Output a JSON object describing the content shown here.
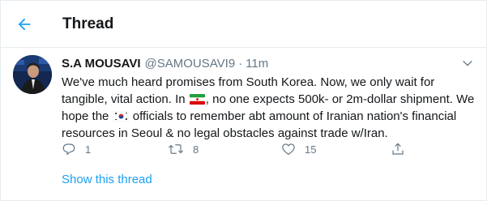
{
  "header": {
    "title": "Thread",
    "back_icon": "arrow-left-icon"
  },
  "tweet": {
    "author_name": "S.A MOUSAVI",
    "handle": "@SAMOUSAVI9",
    "separator": "·",
    "time": "11m",
    "text_before_iran_flag": "We've much heard promises from South Korea. Now, we only wait for tangible, vital action. In ",
    "text_after_iran_flag": ", no one expects 500k- or 2m-dollar shipment. We hope the ",
    "text_after_korea_flag": " officials to remember abt amount of Iranian nation's financial resources in Seoul & no legal obstacles against trade w/Iran."
  },
  "actions": {
    "reply_count": "1",
    "retweet_count": "8",
    "like_count": "15"
  },
  "show_thread_label": "Show this thread",
  "colors": {
    "accent": "#1da1f2",
    "text": "#14171a",
    "secondary": "#657786",
    "divider": "#e6ecf0"
  }
}
